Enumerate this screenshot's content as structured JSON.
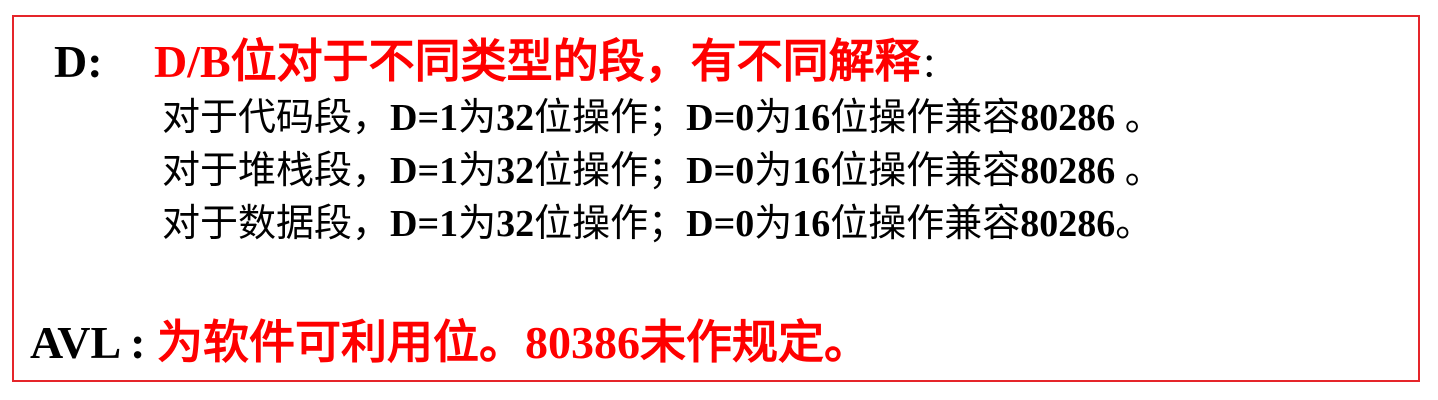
{
  "d_section": {
    "label": "D:",
    "title": "D/B位对于不同类型的段，有不同解释",
    "colon": "：",
    "lines": [
      {
        "segment": "对于代码段，",
        "d1": "D=1",
        "mid": "为",
        "bits32": "32",
        "op1": "位操作；",
        "d0": "D=0",
        "mid2": "为",
        "bits16": "16",
        "op2": "位操作兼容",
        "cpu": "80286",
        "end": " 。"
      },
      {
        "segment": "对于堆栈段，",
        "d1": "D=1",
        "mid": "为",
        "bits32": "32",
        "op1": "位操作；",
        "d0": "D=0",
        "mid2": "为",
        "bits16": "16",
        "op2": "位操作兼容",
        "cpu": "80286",
        "end": " 。"
      },
      {
        "segment": "对于数据段，",
        "d1": "D=1",
        "mid": "为",
        "bits32": "32",
        "op1": "位操作；",
        "d0": "D=0",
        "mid2": "为",
        "bits16": "16",
        "op2": "位操作兼容",
        "cpu": "80286",
        "end": "。"
      }
    ]
  },
  "avl_section": {
    "label": "AVL : ",
    "text": "为软件可利用位。80386未作规定。"
  },
  "colors": {
    "border": "#e5252a",
    "highlight": "#ff0000",
    "text": "#000000"
  }
}
